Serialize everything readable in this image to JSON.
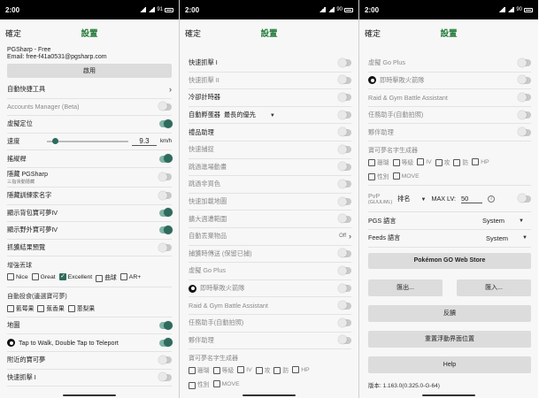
{
  "status": {
    "time": "2:00",
    "battery_p1": "91",
    "battery_p2": "90",
    "battery_p3": "90"
  },
  "appbar": {
    "confirm": "確定",
    "title": "設置"
  },
  "panel1": {
    "app_name": "PGSharp - Free",
    "email": "Email: free-f41a0531@pgsharp.com",
    "enable_button": "啟用",
    "auto_tools": "自動快捷工具",
    "accounts_manager": "Accounts Manager (Beta)",
    "fake_location": "虛擬定位",
    "speed_label": "速度",
    "speed_value": "9.3",
    "speed_unit": "km/h",
    "joystick": "搖縱桿",
    "hide_pgsharp": "隱藏 PGSharp",
    "hide_pgsharp_sub": "三指滑動隱藏",
    "hide_trainer_name": "隱藏訓練家名字",
    "show_bag_iv": "顯示背包寶可夢IV",
    "show_wild_iv": "顯示野外寶可夢IV",
    "catch_preview": "抓獲結果預覽",
    "enhanced_throw": "增強丟球",
    "throws": [
      "Nice",
      "Great",
      "Excellent",
      "曲球",
      "AR+"
    ],
    "auto_feed": "自動投食(邊選寶可夢)",
    "berries": [
      "藍莓果",
      "蕉香果",
      "蔥梨果"
    ],
    "map": "地圖",
    "tap_walk": "Tap to Walk, Double Tap to Teleport",
    "nearby": "附近的寶可夢",
    "quick_catch_1": "快速抓擊 I"
  },
  "panel2": {
    "quick_catch_1": "快速抓擊 I",
    "quick_catch_2": "快速抓擊 II",
    "cooldown_timer": "冷卻計時器",
    "auto_hatch": "自動孵蛋器",
    "hatch_option": "最長的優先",
    "gift_helper": "禮品助理",
    "quick_catch": "快速捕捉",
    "skip_evolve_anim": "跳過進場動畫",
    "skip_cutscene": "跳過非買色",
    "fast_map_load": "快速加載地圖",
    "expand_range": "擴大週遭範圍",
    "auto_discard": "自動丟棄物品",
    "auto_discard_value": "Off",
    "catch_transfer": "捕獲時傳送 (保留已捕)",
    "go_plus": "虛擬 Go Plus",
    "instant_capture": "即時擊敗火箭隊",
    "raid_assistant": "Raid & Gym Battle Assistant",
    "task_helper": "任務助手(自動拍照)",
    "pal_helper": "夥伴助理",
    "name_gen_title": "寶可夢名字生成器",
    "name_gen_row1": [
      "珊瑚",
      "等級",
      "IV",
      "攻",
      "防",
      "HP"
    ],
    "name_gen_row2": [
      "性別",
      "MOVE"
    ]
  },
  "panel3": {
    "go_plus": "虛擬 Go Plus",
    "instant_capture": "即時擊敗火箭隊",
    "raid_assistant": "Raid & Gym Battle Assistant",
    "task_helper": "任務助手(自動拍照)",
    "pal_helper": "夥伴助理",
    "name_gen_title": "寶可夢名字生成器",
    "name_gen_row1": [
      "珊瑚",
      "等級",
      "IV",
      "攻",
      "防",
      "HP"
    ],
    "name_gen_row2": [
      "性別",
      "MOVE"
    ],
    "pvp_label": "PvP",
    "pvp_sub": "(GL/UL/ML)",
    "pvp_rank": "排名",
    "max_lv_label": "MAX LV:",
    "max_lv_value": "50",
    "pgs_lang_label": "PGS 語言",
    "pgs_lang_value": "System",
    "feeds_lang_label": "Feeds 語言",
    "feeds_lang_value": "System",
    "gws_button": "Pokémon GO Web Store",
    "export_button": "匯出...",
    "import_button": "匯入...",
    "feedback_button": "反饋",
    "reset_float_button": "重置浮動界面位置",
    "help_button": "Help",
    "version": "版本: 1.163.0(0.325.0-G-64)"
  }
}
